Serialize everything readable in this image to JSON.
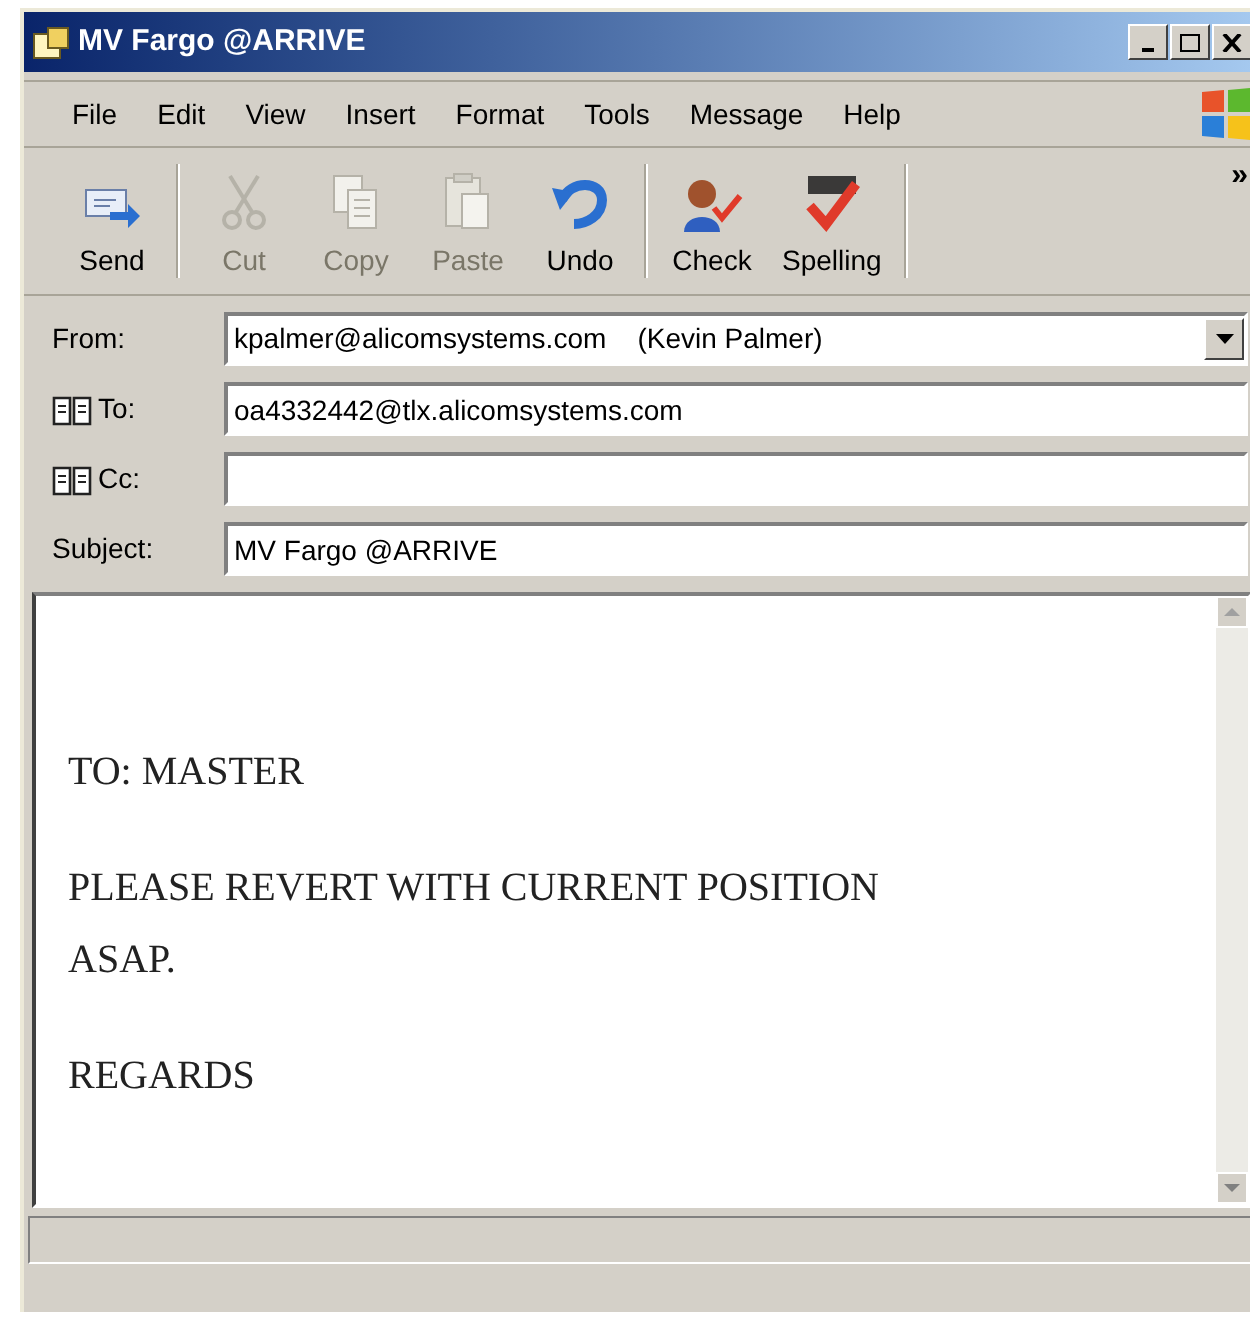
{
  "window": {
    "title": "MV Fargo @ARRIVE"
  },
  "menu": [
    "File",
    "Edit",
    "View",
    "Insert",
    "Format",
    "Tools",
    "Message",
    "Help"
  ],
  "toolbar": [
    {
      "label": "Send",
      "disabled": false,
      "kind": "send"
    },
    {
      "label": "Cut",
      "disabled": true,
      "kind": "cut"
    },
    {
      "label": "Copy",
      "disabled": true,
      "kind": "copy"
    },
    {
      "label": "Paste",
      "disabled": true,
      "kind": "paste"
    },
    {
      "label": "Undo",
      "disabled": false,
      "kind": "undo"
    },
    {
      "label": "Check",
      "disabled": false,
      "kind": "check"
    },
    {
      "label": "Spelling",
      "disabled": false,
      "kind": "spelling"
    }
  ],
  "toolbar_overflow": "»",
  "fields": [
    {
      "label": "From:",
      "kind": "select",
      "value": "kpalmer@alicomsystems.com    (Kevin Palmer)"
    },
    {
      "label": "To:",
      "kind": "address",
      "value": "oa4332442@tlx.alicomsystems.com"
    },
    {
      "label": "Cc:",
      "kind": "address"
    },
    {
      "label": "Subject:",
      "kind": "plain",
      "value": "MV Fargo @ARRIVE"
    }
  ],
  "body": [
    "TO: MASTER",
    "PLEASE REVERT WITH CURRENT POSITION ASAP.",
    "REGARDS"
  ]
}
